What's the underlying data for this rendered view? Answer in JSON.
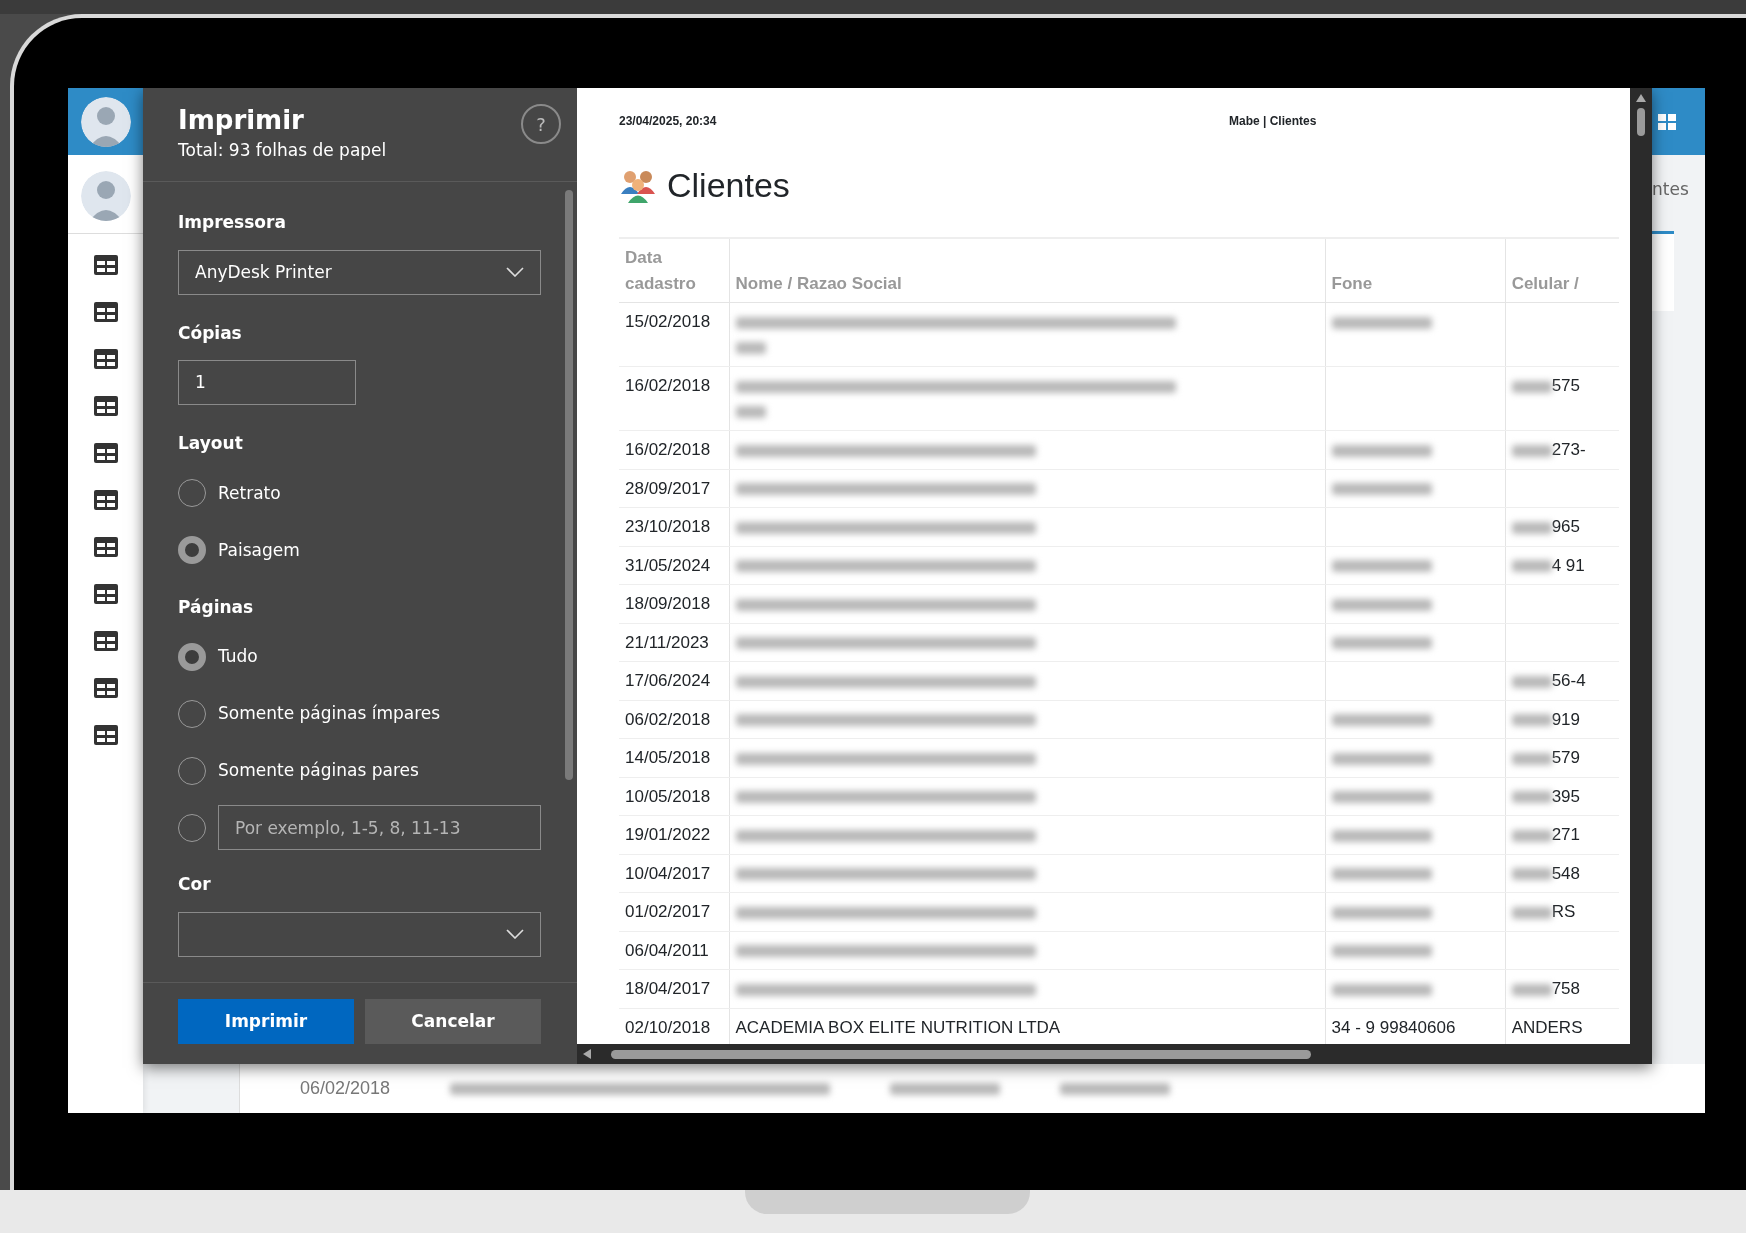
{
  "app_sidebar": {
    "items": [
      {
        "kind": "table"
      },
      {
        "kind": "table"
      },
      {
        "kind": "table"
      },
      {
        "kind": "table"
      },
      {
        "kind": "table"
      },
      {
        "kind": "table"
      },
      {
        "kind": "table"
      },
      {
        "kind": "table"
      },
      {
        "kind": "table"
      },
      {
        "kind": "table"
      },
      {
        "kind": "table"
      }
    ]
  },
  "print_dialog": {
    "title": "Imprimir",
    "subtitle": "Total: 93 folhas de papel",
    "help": "?",
    "sections": [
      {
        "kind": "select",
        "label": "Impressora",
        "value": "AnyDesk Printer"
      },
      {
        "kind": "input",
        "label": "Cópias",
        "value": "1"
      },
      {
        "kind": "radio",
        "label": "Layout",
        "options": [
          {
            "label": "Retrato",
            "selected": false
          },
          {
            "label": "Paisagem",
            "selected": true
          }
        ]
      },
      {
        "kind": "radio",
        "label": "Páginas",
        "options": [
          {
            "label": "Tudo",
            "selected": true
          },
          {
            "label": "Somente páginas ímpares",
            "selected": false
          },
          {
            "label": "Somente páginas pares",
            "selected": false
          },
          {
            "placeholder": "Por exemplo, 1-5, 8, 11-13",
            "selected": false
          }
        ]
      },
      {
        "kind": "select",
        "label": "Cor"
      }
    ],
    "buttons": [
      {
        "label": "Imprimir",
        "kind": "primary"
      },
      {
        "label": "Cancelar",
        "kind": "secondary"
      }
    ]
  },
  "preview": {
    "timestamp": "23/04/2025, 20:34",
    "header": "Mabe | Clientes",
    "title": "Clientes",
    "columns": [
      "Data cadastro",
      "Nome / Razao Social",
      "Fone",
      "Celular /"
    ],
    "rows": [
      {
        "date": "15/02/2018",
        "name_wrapped": true,
        "phone_redacted": true,
        "mobile_redacted": false
      },
      {
        "date": "16/02/2018",
        "name_wrapped": true,
        "phone_redacted": false,
        "mobile_redacted": true,
        "mobile": "575"
      },
      {
        "date": "16/02/2018",
        "name_wrapped": false,
        "phone_redacted": true,
        "mobile_redacted": true,
        "mobile": "273-"
      },
      {
        "date": "28/09/2017",
        "name_wrapped": false,
        "phone_redacted": true,
        "mobile_redacted": false
      },
      {
        "date": "23/10/2018",
        "name_wrapped": false,
        "phone_redacted": false,
        "mobile_redacted": true,
        "mobile": "965"
      },
      {
        "date": "31/05/2024",
        "name_wrapped": false,
        "phone_redacted": true,
        "mobile_redacted": true,
        "mobile": "4 91"
      },
      {
        "date": "18/09/2018",
        "name_wrapped": false,
        "phone_redacted": true,
        "mobile_redacted": false
      },
      {
        "date": "21/11/2023",
        "name_wrapped": false,
        "phone_redacted": true,
        "mobile_redacted": false
      },
      {
        "date": "17/06/2024",
        "name_wrapped": false,
        "phone_redacted": false,
        "mobile_redacted": true,
        "mobile": "56-4"
      },
      {
        "date": "06/02/2018",
        "name_wrapped": false,
        "phone_redacted": true,
        "mobile_redacted": true,
        "mobile": "919"
      },
      {
        "date": "14/05/2018",
        "name_wrapped": false,
        "phone_redacted": true,
        "mobile_redacted": true,
        "mobile": "579"
      },
      {
        "date": "10/05/2018",
        "name_wrapped": false,
        "phone_redacted": true,
        "mobile_redacted": true,
        "mobile": "395"
      },
      {
        "date": "19/01/2022",
        "name_wrapped": false,
        "phone_redacted": true,
        "mobile_redacted": true,
        "mobile": "271"
      },
      {
        "date": "10/04/2017",
        "name_wrapped": false,
        "phone_redacted": true,
        "mobile_redacted": true,
        "mobile": "548"
      },
      {
        "date": "01/02/2017",
        "name_wrapped": false,
        "phone_redacted": true,
        "mobile_redacted": true,
        "mobile": "RS"
      },
      {
        "date": "06/04/2011",
        "name_wrapped": false,
        "phone_redacted": true,
        "mobile_redacted": false
      },
      {
        "date": "18/04/2017",
        "name_wrapped": false,
        "phone_redacted": true,
        "mobile_redacted": true,
        "mobile": "758"
      },
      {
        "date": "02/10/2018",
        "name": "ACADEMIA BOX ELITE NUTRITION LTDA",
        "phone": "34 - 9 99840606",
        "mobile": "ANDERS"
      }
    ]
  },
  "background_app": {
    "tab_fragment": "ntes",
    "row_date": "06/02/2018"
  }
}
